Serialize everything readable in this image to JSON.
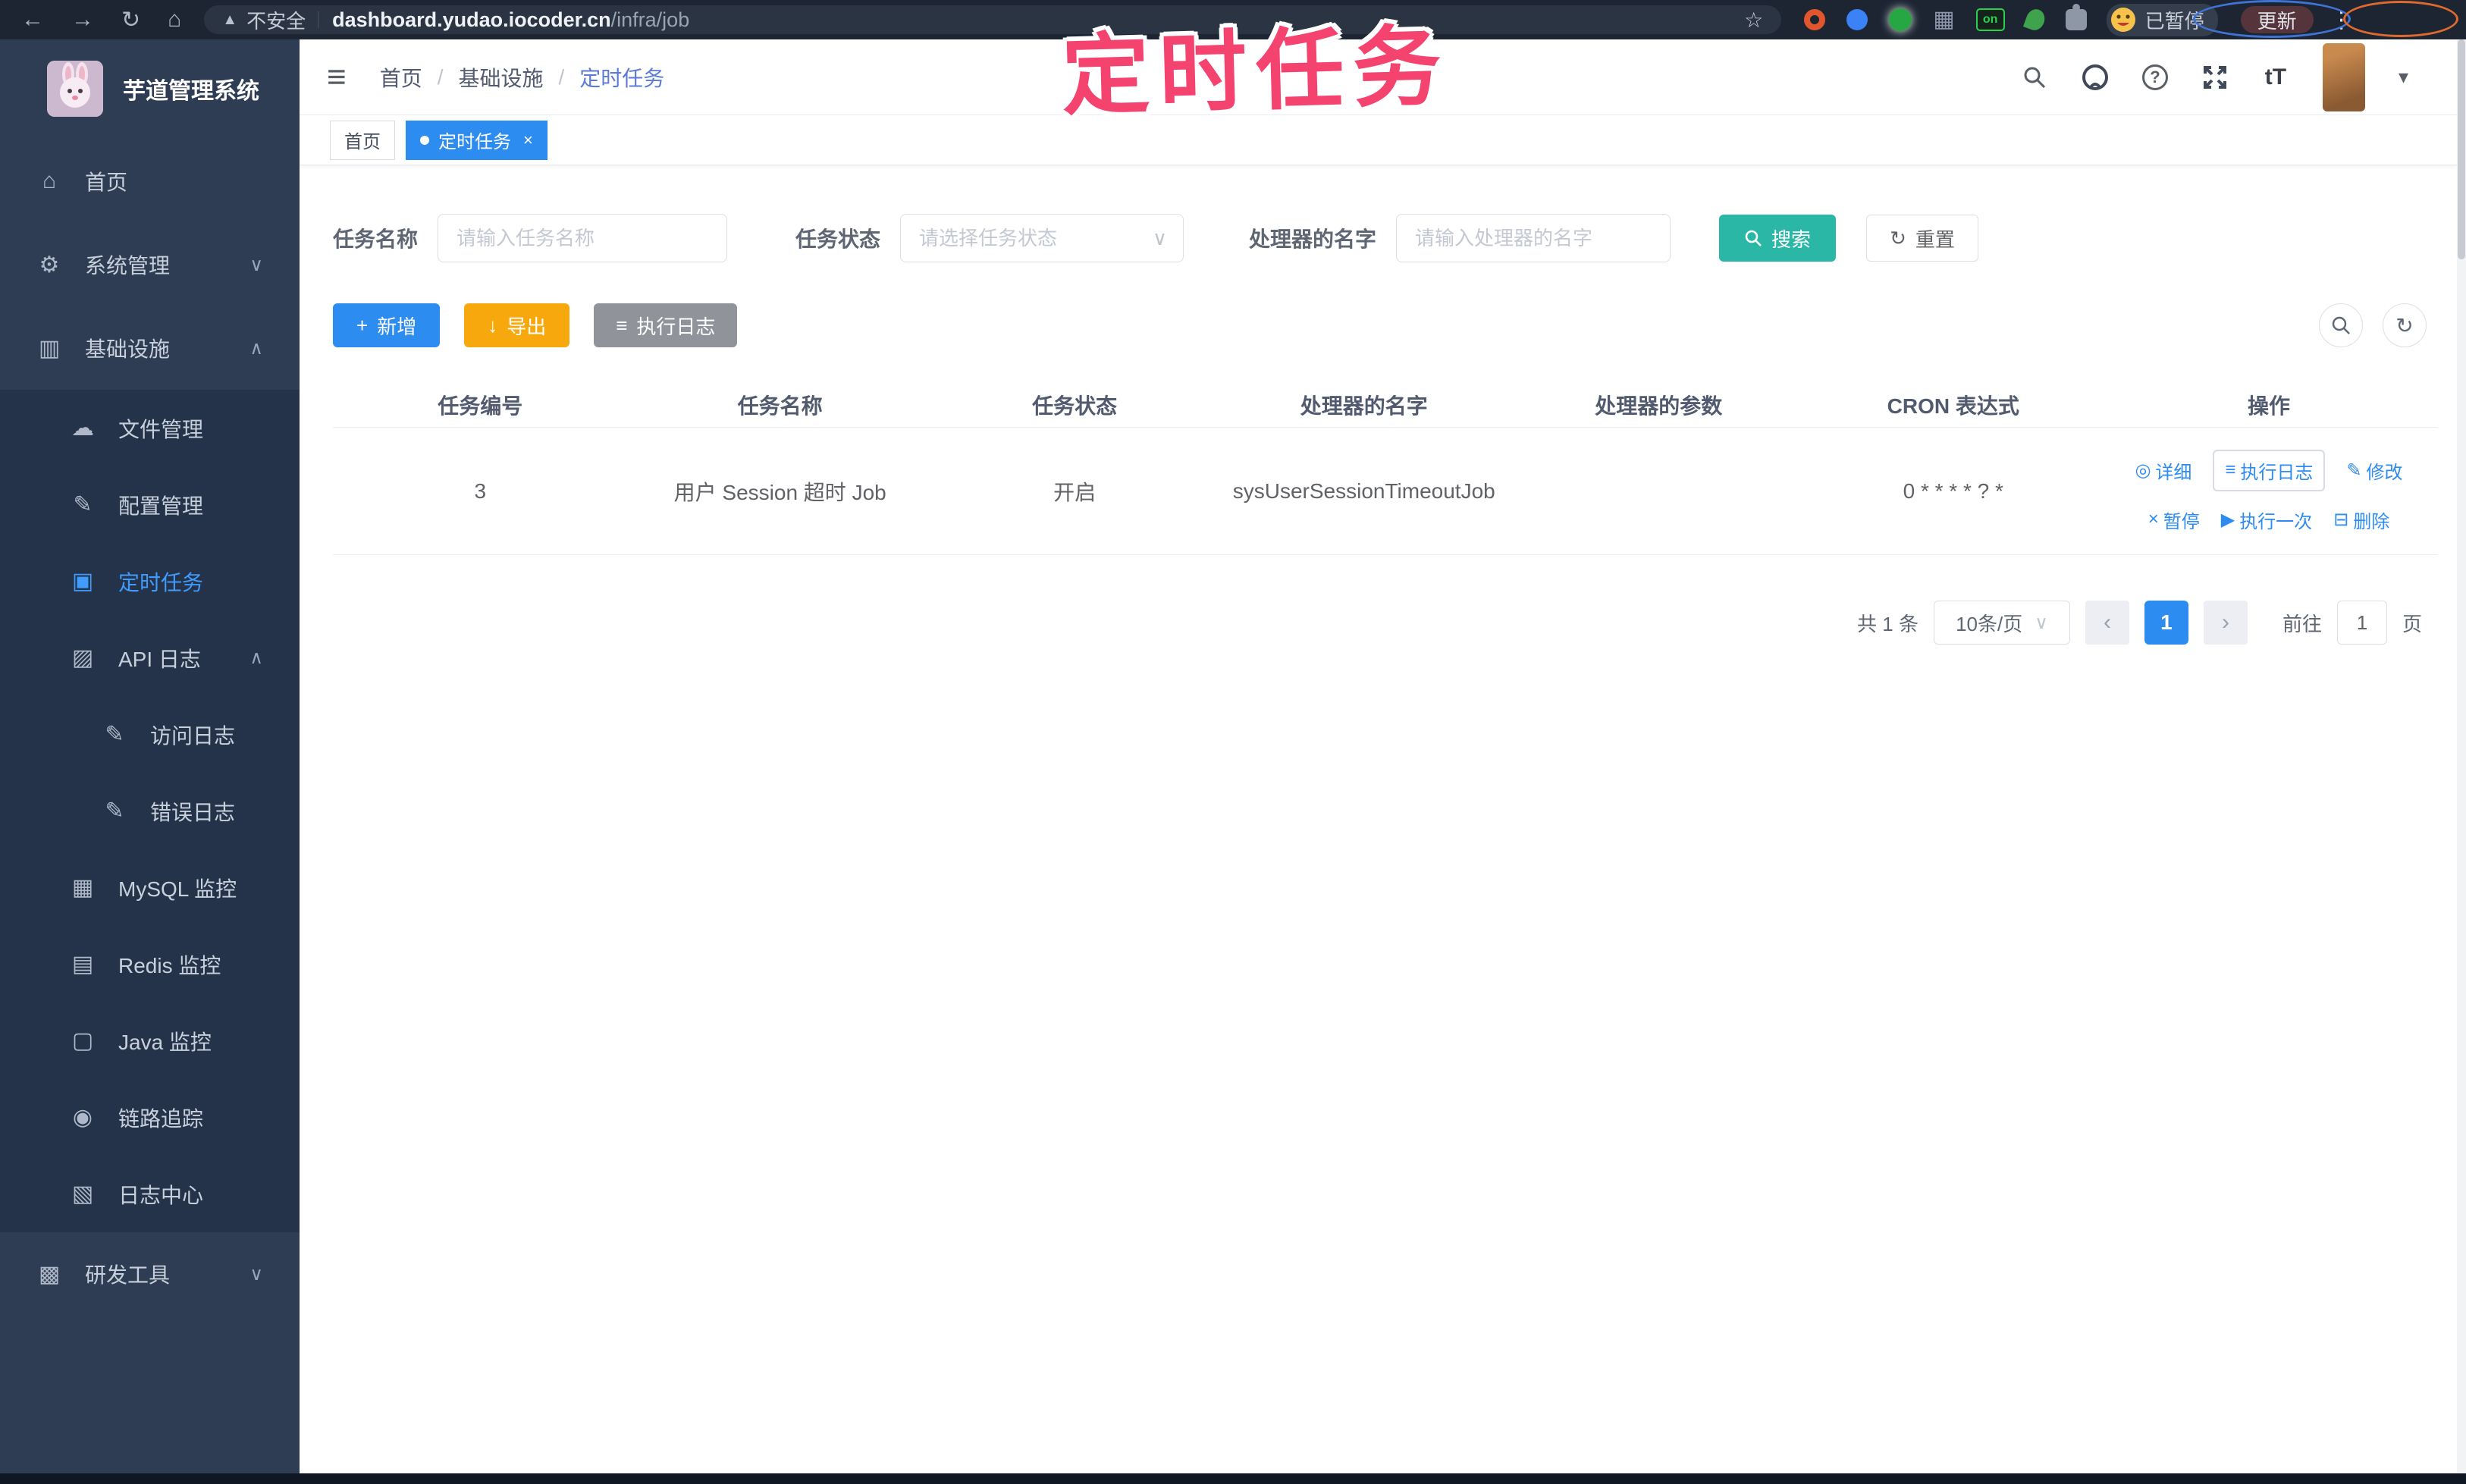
{
  "browser": {
    "back_icon": "←",
    "forward_icon": "→",
    "reload_icon": "↻",
    "home_icon": "⌂",
    "warning_icon": "▲",
    "security_label": "不安全",
    "url_host": "dashboard.yudao.iocoder.cn",
    "url_path": "/infra/job",
    "bookmark_star_icon": "☆",
    "grid_icon": "▦",
    "extension_on_badge": "on",
    "profile_status": "已暂停",
    "update_label": "更新",
    "kebab_icon": "⋮"
  },
  "annotation": {
    "text": "定时任务",
    "color": "#f4436e"
  },
  "icons": {
    "chevron_down": "∨",
    "chevron_up": "∧",
    "caret_down": "▾",
    "hamburger": "≡",
    "breadcrumb_sep": "/",
    "select_caret": "∨",
    "help": "?",
    "text_size": "tT",
    "prev": "‹",
    "next": "›"
  },
  "sidebar": {
    "logo_title": "芋道管理系统",
    "items": [
      {
        "glyph": "⌂",
        "label": "首页"
      },
      {
        "glyph": "⚙",
        "label": "系统管理"
      },
      {
        "glyph": "▥",
        "label": "基础设施"
      },
      {
        "glyph": "☁",
        "label": "文件管理"
      },
      {
        "glyph": "✎",
        "label": "配置管理"
      },
      {
        "glyph": "▣",
        "label": "定时任务"
      },
      {
        "glyph": "▨",
        "label": "API 日志"
      },
      {
        "glyph": "✎",
        "label": "访问日志"
      },
      {
        "glyph": "✎",
        "label": "错误日志"
      },
      {
        "glyph": "▦",
        "label": "MySQL 监控"
      },
      {
        "glyph": "▤",
        "label": "Redis 监控"
      },
      {
        "glyph": "▢",
        "label": "Java 监控"
      },
      {
        "glyph": "◉",
        "label": "链路追踪"
      },
      {
        "glyph": "▧",
        "label": "日志中心"
      },
      {
        "glyph": "▩",
        "label": "研发工具"
      }
    ]
  },
  "header": {
    "breadcrumb": [
      "首页",
      "基础设施",
      "定时任务"
    ]
  },
  "tabs": [
    {
      "label": "首页"
    },
    {
      "label": "定时任务",
      "close_icon": "×"
    }
  ],
  "filters": {
    "name_label": "任务名称",
    "name_placeholder": "请输入任务名称",
    "status_label": "任务状态",
    "status_placeholder": "请选择任务状态",
    "handler_label": "处理器的名字",
    "handler_placeholder": "请输入处理器的名字",
    "search_label": "搜索",
    "reset_label": "重置",
    "reset_icon": "↻"
  },
  "toolbar": {
    "add_icon": "+",
    "add_label": "新增",
    "export_icon": "↓",
    "export_label": "导出",
    "exec_log_icon": "≡",
    "exec_log_label": "执行日志",
    "search_toggle_icon": "⌕",
    "refresh_icon": "↻"
  },
  "table": {
    "headers": [
      "任务编号",
      "任务名称",
      "任务状态",
      "处理器的名字",
      "处理器的参数",
      "CRON 表达式",
      "操作"
    ],
    "rows": [
      {
        "id": "3",
        "name": "用户 Session 超时 Job",
        "status": "开启",
        "handler": "sysUserSessionTimeoutJob",
        "param": "",
        "cron": "0 * * * * ? *"
      }
    ],
    "ops_row1": [
      {
        "icon": "◎",
        "label": "详细"
      },
      {
        "icon": "≡",
        "label": "执行日志"
      },
      {
        "icon": "✎",
        "label": "修改"
      }
    ],
    "ops_row2": [
      {
        "icon": "×",
        "label": "暂停"
      },
      {
        "icon": "▶",
        "label": "执行一次"
      },
      {
        "icon": "⊟",
        "label": "删除"
      }
    ]
  },
  "pagination": {
    "total": "共 1 条",
    "page_size": "10条/页",
    "page": "1",
    "goto_label": "前往",
    "goto_value": "1",
    "unit_label": "页"
  },
  "colors": {
    "accent_blue": "#2d8cf0",
    "teal": "#2ab7a5",
    "warning_orange": "#f7a80d",
    "info_gray": "#909399",
    "sidebar_bg": "#2e3c54",
    "submenu_bg": "#24334a",
    "annotation_pink": "#f4436e"
  }
}
